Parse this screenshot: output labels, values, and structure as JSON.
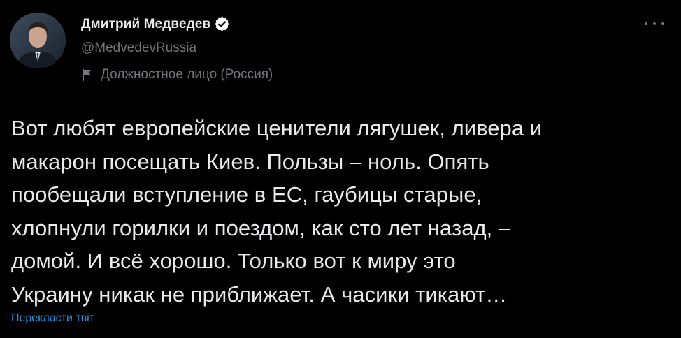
{
  "colors": {
    "background": "#000000",
    "text_primary": "#e7e9ea",
    "text_secondary": "#71767b",
    "link": "#1d9bf0"
  },
  "author": {
    "name": "Дмитрий Медведев",
    "handle": "@MedvedevRussia",
    "verified_icon": "verified-badge-icon",
    "label": "Должностное лицо (Россия)",
    "label_icon": "flag-icon"
  },
  "more_icon": "more-dots-icon",
  "tweet": {
    "lines": [
      "Вот любят европейские ценители лягушек, ливера и",
      "макарон посещать Киев. Пользы – ноль. Опять",
      "пообещали вступление в ЕС, гаубицы старые,",
      "хлопнули горилки и поездом, как сто лет назад, –",
      "домой. И всё хорошо. Только вот к миру это",
      "Украину никак не приближает. А часики тикают…"
    ]
  },
  "translate_link": "Перекласти твіт"
}
